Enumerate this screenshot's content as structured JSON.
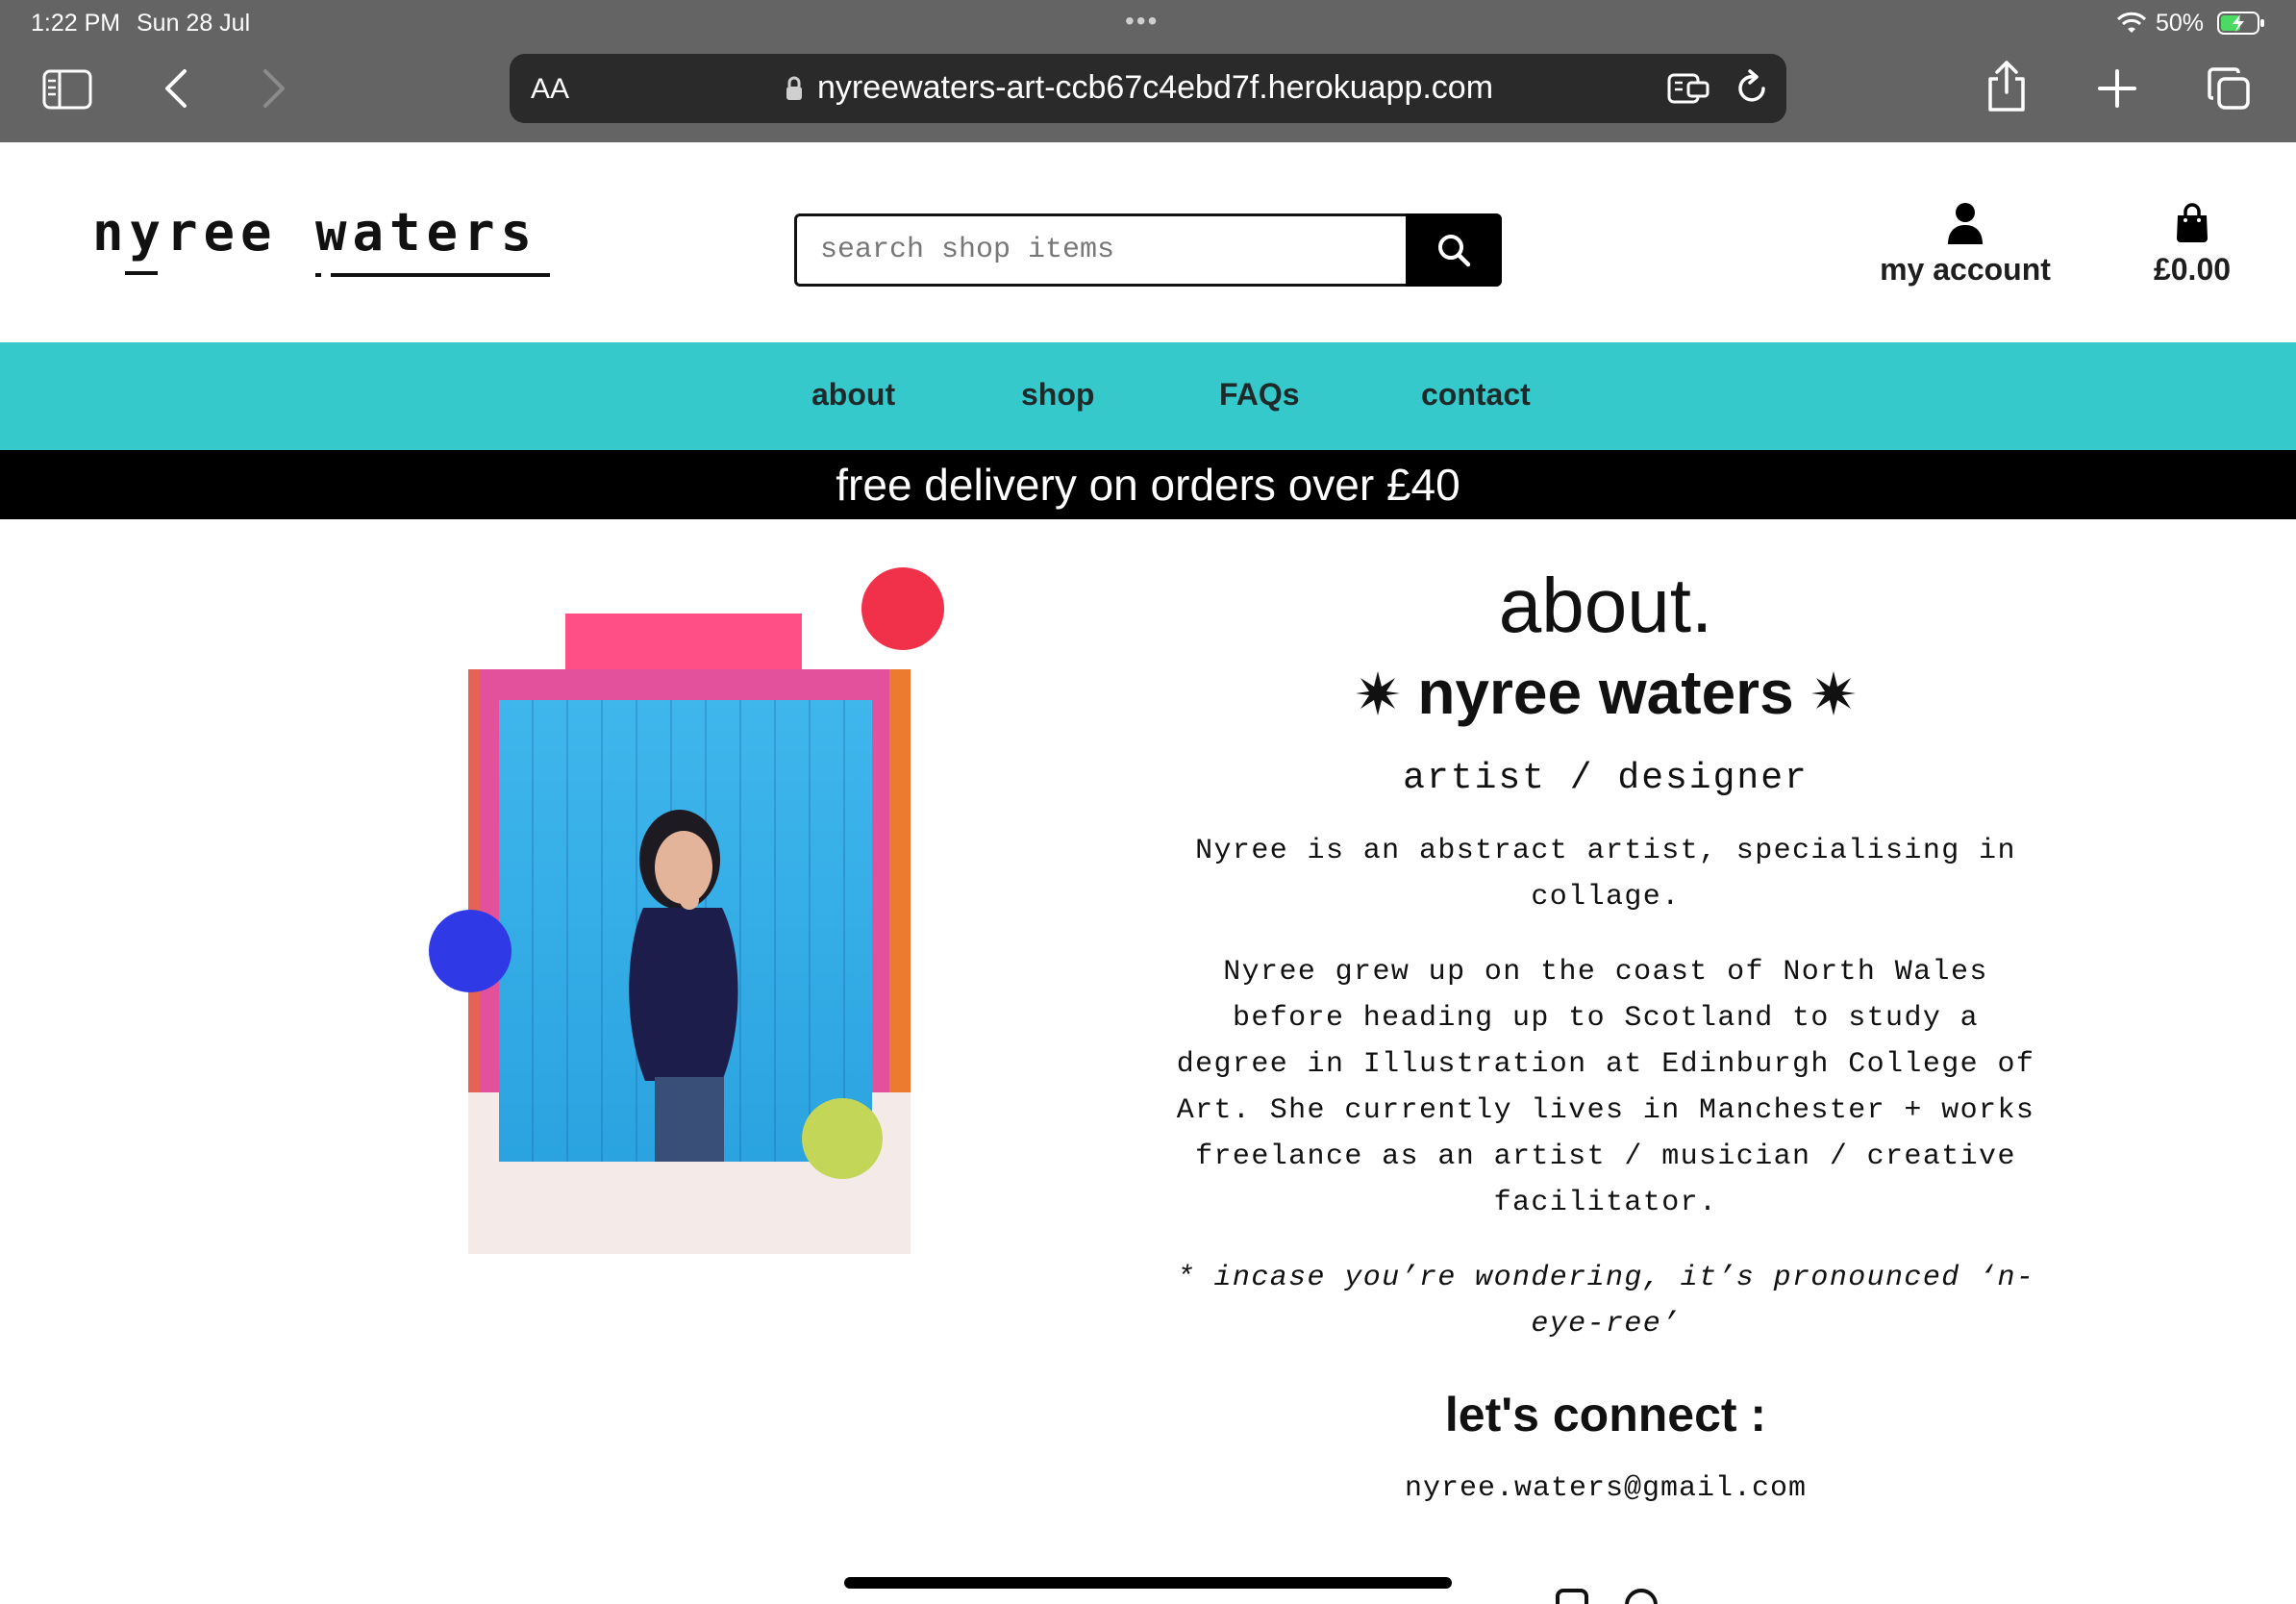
{
  "status_bar": {
    "time": "1:22 PM",
    "date": "Sun 28 Jul",
    "battery": "50%"
  },
  "browser": {
    "text_size_label": "AA",
    "url": "nyreewaters-art-ccb67c4ebd7f.herokuapp.com",
    "icons": [
      "sidebar-icon",
      "back-icon",
      "forward-icon",
      "lock-icon",
      "reader-icon",
      "reload-icon",
      "share-icon",
      "new-tab-icon",
      "tabs-icon"
    ]
  },
  "header": {
    "logo_word_1": "nyree",
    "logo_word_2": "waters",
    "search_placeholder": "search shop items",
    "account_label": "my account",
    "bag_total": "£0.00"
  },
  "nav": {
    "items": [
      "about",
      "shop",
      "FAQs",
      "contact"
    ]
  },
  "promo": "free delivery on orders over £40",
  "about": {
    "title": "about.",
    "name": "nyree waters",
    "role": "artist / designer",
    "paragraph_1": "Nyree is an abstract artist, specialising in collage.",
    "paragraph_2": "Nyree grew up on the coast of North Wales before heading up to Scotland to study a degree in Illustration at Edinburgh College of Art. She currently lives in Manchester + works freelance as an artist / musician / creative facilitator.",
    "note": "* incase you’re wondering, it’s pronounced ‘n-eye-ree’",
    "connect_title": "let's connect :",
    "email": "nyree.waters@gmail.com"
  },
  "colors": {
    "nav_bg": "#35c9cc",
    "promo_bg": "#000000",
    "dot_red": "#f1304a",
    "dot_blue": "#3039e6",
    "dot_lime": "#c4d658",
    "tape_pink": "#ff4f86",
    "frame_pink": "#e3509b"
  }
}
